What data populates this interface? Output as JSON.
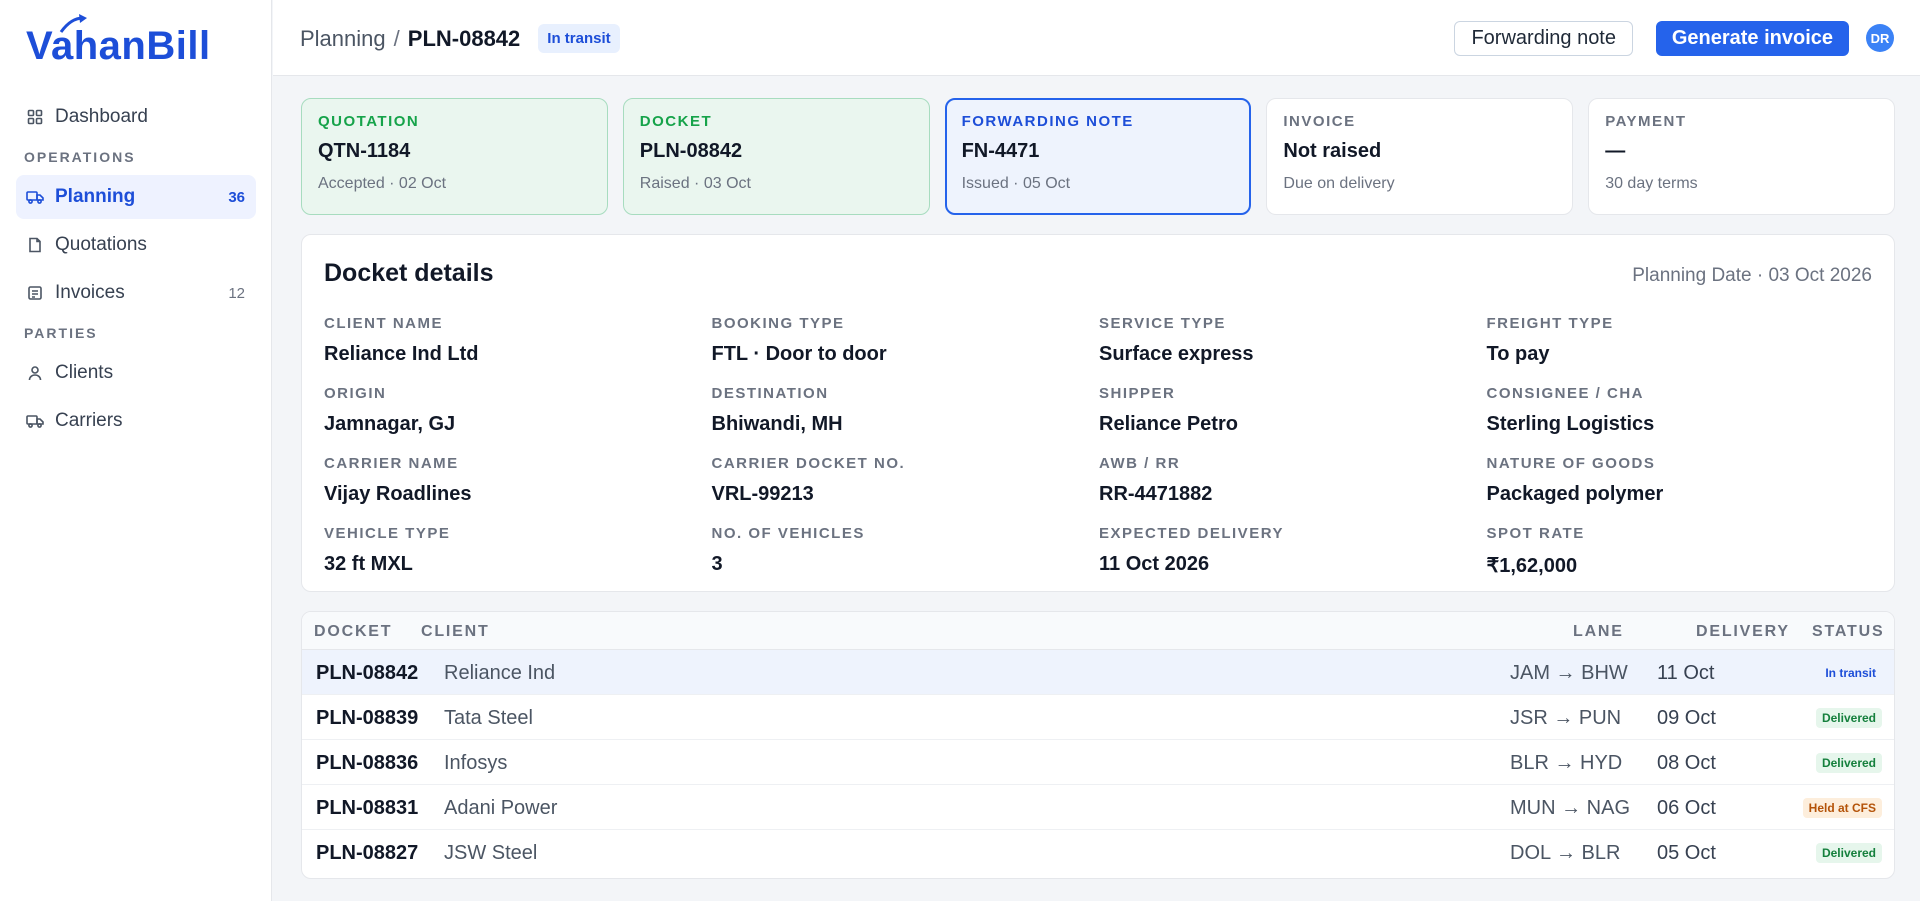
{
  "brand": {
    "name": "VahanBill"
  },
  "sidebar": {
    "items": [
      {
        "label": "Dashboard",
        "icon": "dashboard-icon",
        "count": ""
      },
      {
        "section": "OPERATIONS"
      },
      {
        "label": "Planning",
        "icon": "truck-icon",
        "count": "36",
        "active": true
      },
      {
        "label": "Quotations",
        "icon": "document-icon",
        "count": ""
      },
      {
        "label": "Invoices",
        "icon": "invoice-icon",
        "count": "12"
      },
      {
        "section": "PARTIES"
      },
      {
        "label": "Clients",
        "icon": "user-icon",
        "count": ""
      },
      {
        "label": "Carriers",
        "icon": "truck-icon",
        "count": ""
      }
    ]
  },
  "header": {
    "breadcrumb_parent": "Planning",
    "breadcrumb_separator": "/",
    "breadcrumb_current": "PLN-08842",
    "status_badge": "In transit",
    "forwarding_note_label": "Forwarding note",
    "generate_invoice_label": "Generate invoice",
    "avatar_initials": "DR"
  },
  "stages": [
    {
      "label": "QUOTATION",
      "value": "QTN-1184",
      "sub": "Accepted · 02 Oct",
      "state": "done"
    },
    {
      "label": "DOCKET",
      "value": "PLN-08842",
      "sub": "Raised · 03 Oct",
      "state": "done"
    },
    {
      "label": "FORWARDING NOTE",
      "value": "FN-4471",
      "sub": "Issued · 05 Oct",
      "state": "current"
    },
    {
      "label": "INVOICE",
      "value": "Not raised",
      "sub": "Due on delivery",
      "state": "pending"
    },
    {
      "label": "PAYMENT",
      "value": "—",
      "sub": "30 day terms",
      "state": "pending"
    }
  ],
  "details": {
    "title": "Docket details",
    "planning_date": "Planning Date · 03 Oct 2026",
    "fields": [
      {
        "label": "CLIENT NAME",
        "value": "Reliance Ind Ltd"
      },
      {
        "label": "BOOKING TYPE",
        "value": "FTL · Door to door"
      },
      {
        "label": "SERVICE TYPE",
        "value": "Surface express"
      },
      {
        "label": "FREIGHT TYPE",
        "value": "To pay"
      },
      {
        "label": "ORIGIN",
        "value": "Jamnagar, GJ"
      },
      {
        "label": "DESTINATION",
        "value": "Bhiwandi, MH"
      },
      {
        "label": "SHIPPER",
        "value": "Reliance Petro"
      },
      {
        "label": "CONSIGNEE / CHA",
        "value": "Sterling Logistics"
      },
      {
        "label": "CARRIER NAME",
        "value": "Vijay Roadlines"
      },
      {
        "label": "CARRIER DOCKET NO.",
        "value": "VRL-99213"
      },
      {
        "label": "AWB / RR",
        "value": "RR-4471882"
      },
      {
        "label": "NATURE OF GOODS",
        "value": "Packaged polymer"
      },
      {
        "label": "VEHICLE TYPE",
        "value": "32 ft MXL"
      },
      {
        "label": "NO. OF VEHICLES",
        "value": "3"
      },
      {
        "label": "EXPECTED DELIVERY",
        "value": "11 Oct 2026"
      },
      {
        "label": "SPOT RATE",
        "value": "₹1,62,000"
      }
    ]
  },
  "table": {
    "headers": {
      "docket": "DOCKET",
      "client": "CLIENT",
      "lane": "LANE",
      "delivery": "DELIVERY",
      "status": "STATUS"
    },
    "rows": [
      {
        "docket": "PLN-08842",
        "client": "Reliance Ind",
        "lane": "JAM → BHW",
        "delivery": "11 Oct",
        "status": "In transit",
        "kind": "transit",
        "selected": true
      },
      {
        "docket": "PLN-08839",
        "client": "Tata Steel",
        "lane": "JSR → PUN",
        "delivery": "09 Oct",
        "status": "Delivered",
        "kind": "delivered"
      },
      {
        "docket": "PLN-08836",
        "client": "Infosys",
        "lane": "BLR → HYD",
        "delivery": "08 Oct",
        "status": "Delivered",
        "kind": "delivered"
      },
      {
        "docket": "PLN-08831",
        "client": "Adani Power",
        "lane": "MUN → NAG",
        "delivery": "06 Oct",
        "status": "Held at CFS",
        "kind": "held"
      },
      {
        "docket": "PLN-08827",
        "client": "JSW Steel",
        "lane": "DOL → BLR",
        "delivery": "05 Oct",
        "status": "Delivered",
        "kind": "delivered"
      }
    ]
  },
  "colors": {
    "accent": "#2563eb",
    "success": "#16a34a",
    "warning": "#b45309"
  }
}
